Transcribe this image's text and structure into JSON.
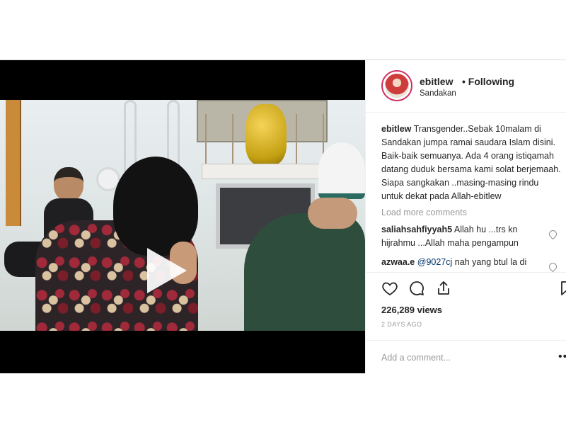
{
  "post": {
    "author": {
      "username": "ebitlew",
      "follow_state": "• Following",
      "location": "Sandakan"
    },
    "caption": {
      "username": "ebitlew",
      "text": "Transgender..Sebak 10malam di Sandakan jumpa ramai saudara Islam disini. Baik-baik semuanya. Ada 4 orang istiqamah datang duduk bersama kami solat berjemaah. Siapa sangkakan ..masing-masing rindu untuk dekat pada Allah-ebitlew"
    },
    "load_more_label": "Load more comments",
    "comments": [
      {
        "username": "saliahsahfiyyah5",
        "text": "Allah hu ...trs kn hijrahmu ...Allah maha pengampun"
      },
      {
        "username": "azwaa.e",
        "mention": "@9027cj",
        "text": "nah yang btul la di"
      }
    ],
    "views": "226,289 views",
    "date": "2 DAYS AGO",
    "add_comment_placeholder": "Add a comment...",
    "more_options_label": "•••"
  },
  "icons": {
    "play": "play-icon",
    "like": "heart-icon",
    "comment": "speech-bubble-icon",
    "share": "share-icon",
    "save": "bookmark-icon",
    "comment_like": "heart-icon"
  },
  "colors": {
    "story_ring": "#d22d5e",
    "text": "#262626",
    "muted": "#999999",
    "mention": "#003569",
    "border": "#dbdbdb"
  }
}
